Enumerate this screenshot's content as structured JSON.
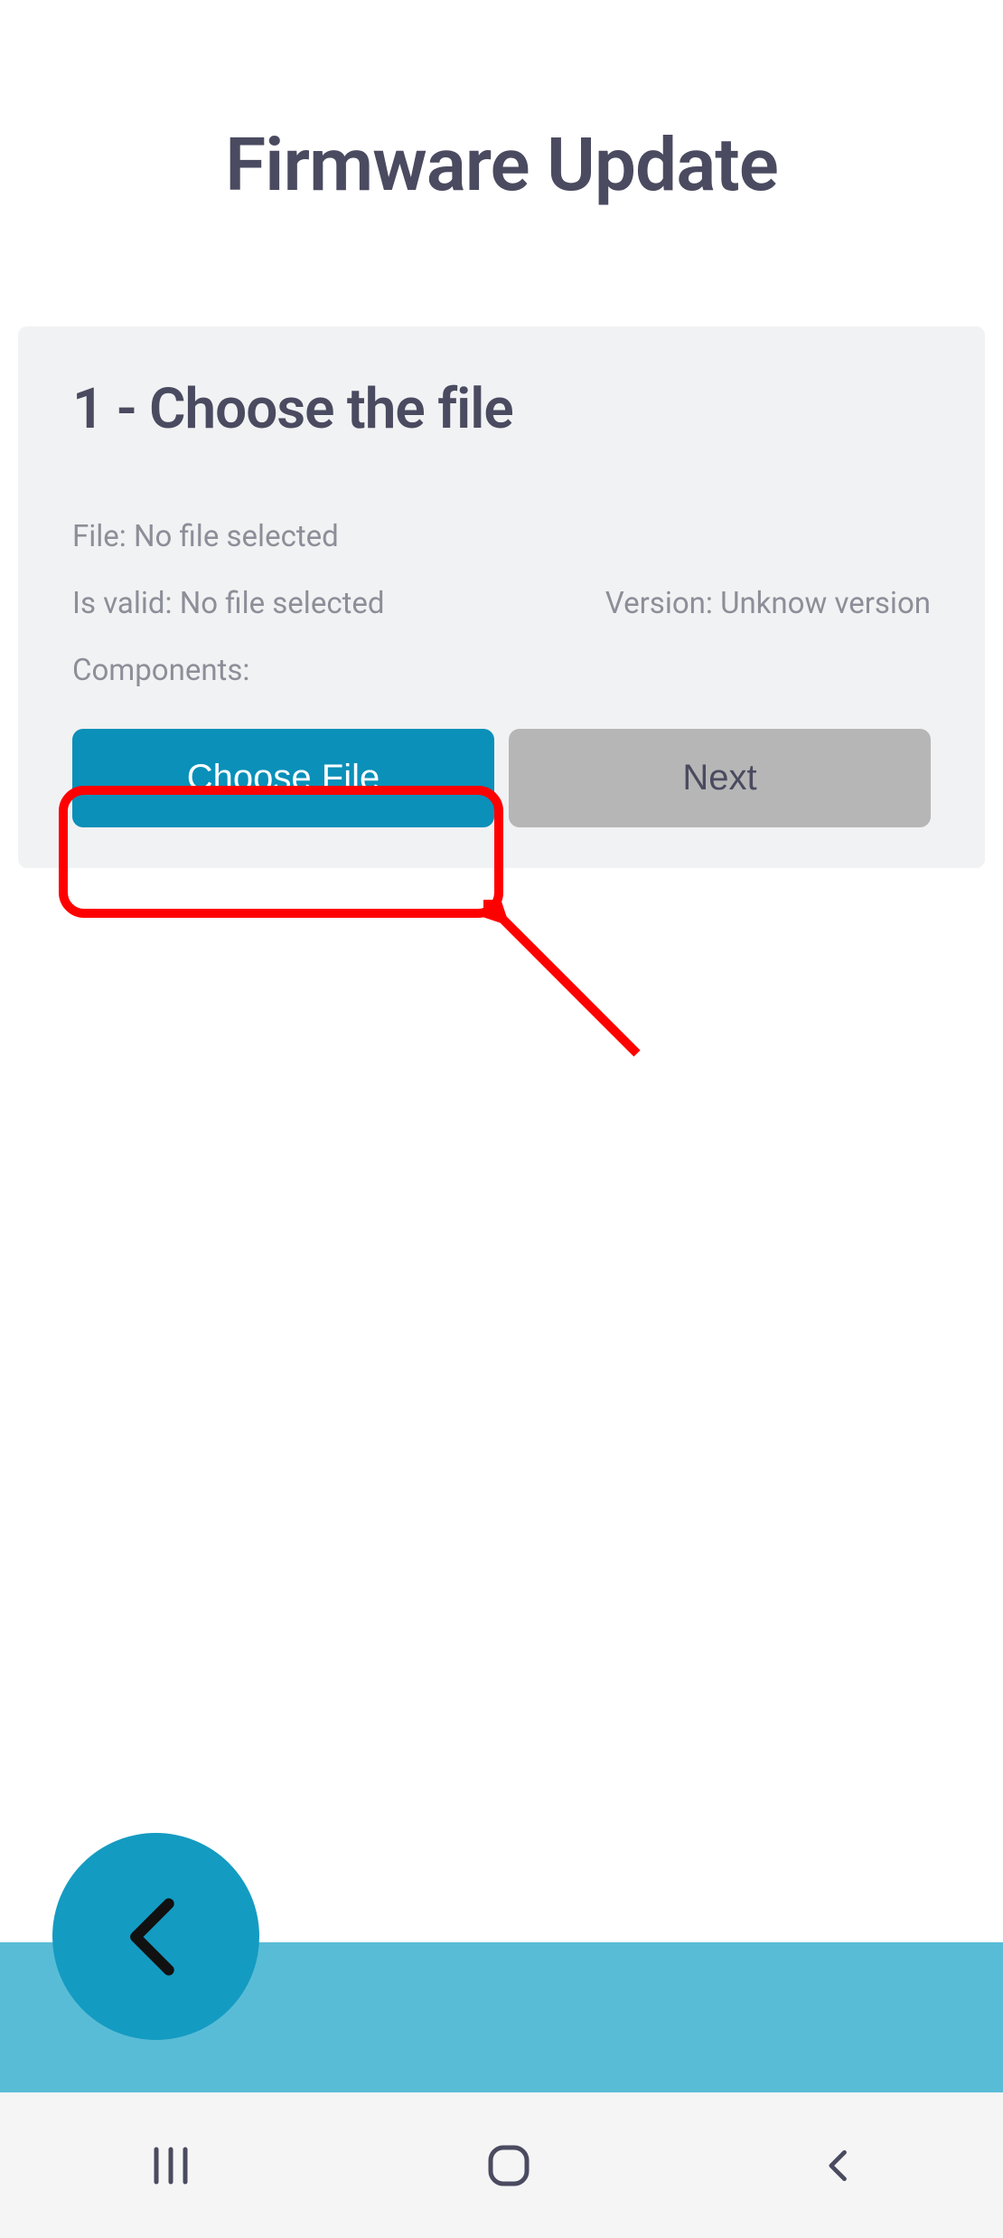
{
  "header": {
    "title": "Firmware Update"
  },
  "step": {
    "title": "1 - Choose the file",
    "file": {
      "label": "File:",
      "value": "No file selected"
    },
    "valid": {
      "label": "Is valid:",
      "value": "No file selected"
    },
    "version": {
      "label": "Version:",
      "value": "Unknow version"
    },
    "components": {
      "label": "Components:",
      "value": ""
    },
    "buttons": {
      "choose": "Choose File",
      "next": "Next"
    }
  },
  "annotation": {
    "highlight_target": "choose-file-button",
    "arrow": true,
    "color": "#ff0000"
  },
  "colors": {
    "primary": "#0a90b9",
    "bottom_bar": "#59bcd7",
    "fab": "#149bc2"
  }
}
